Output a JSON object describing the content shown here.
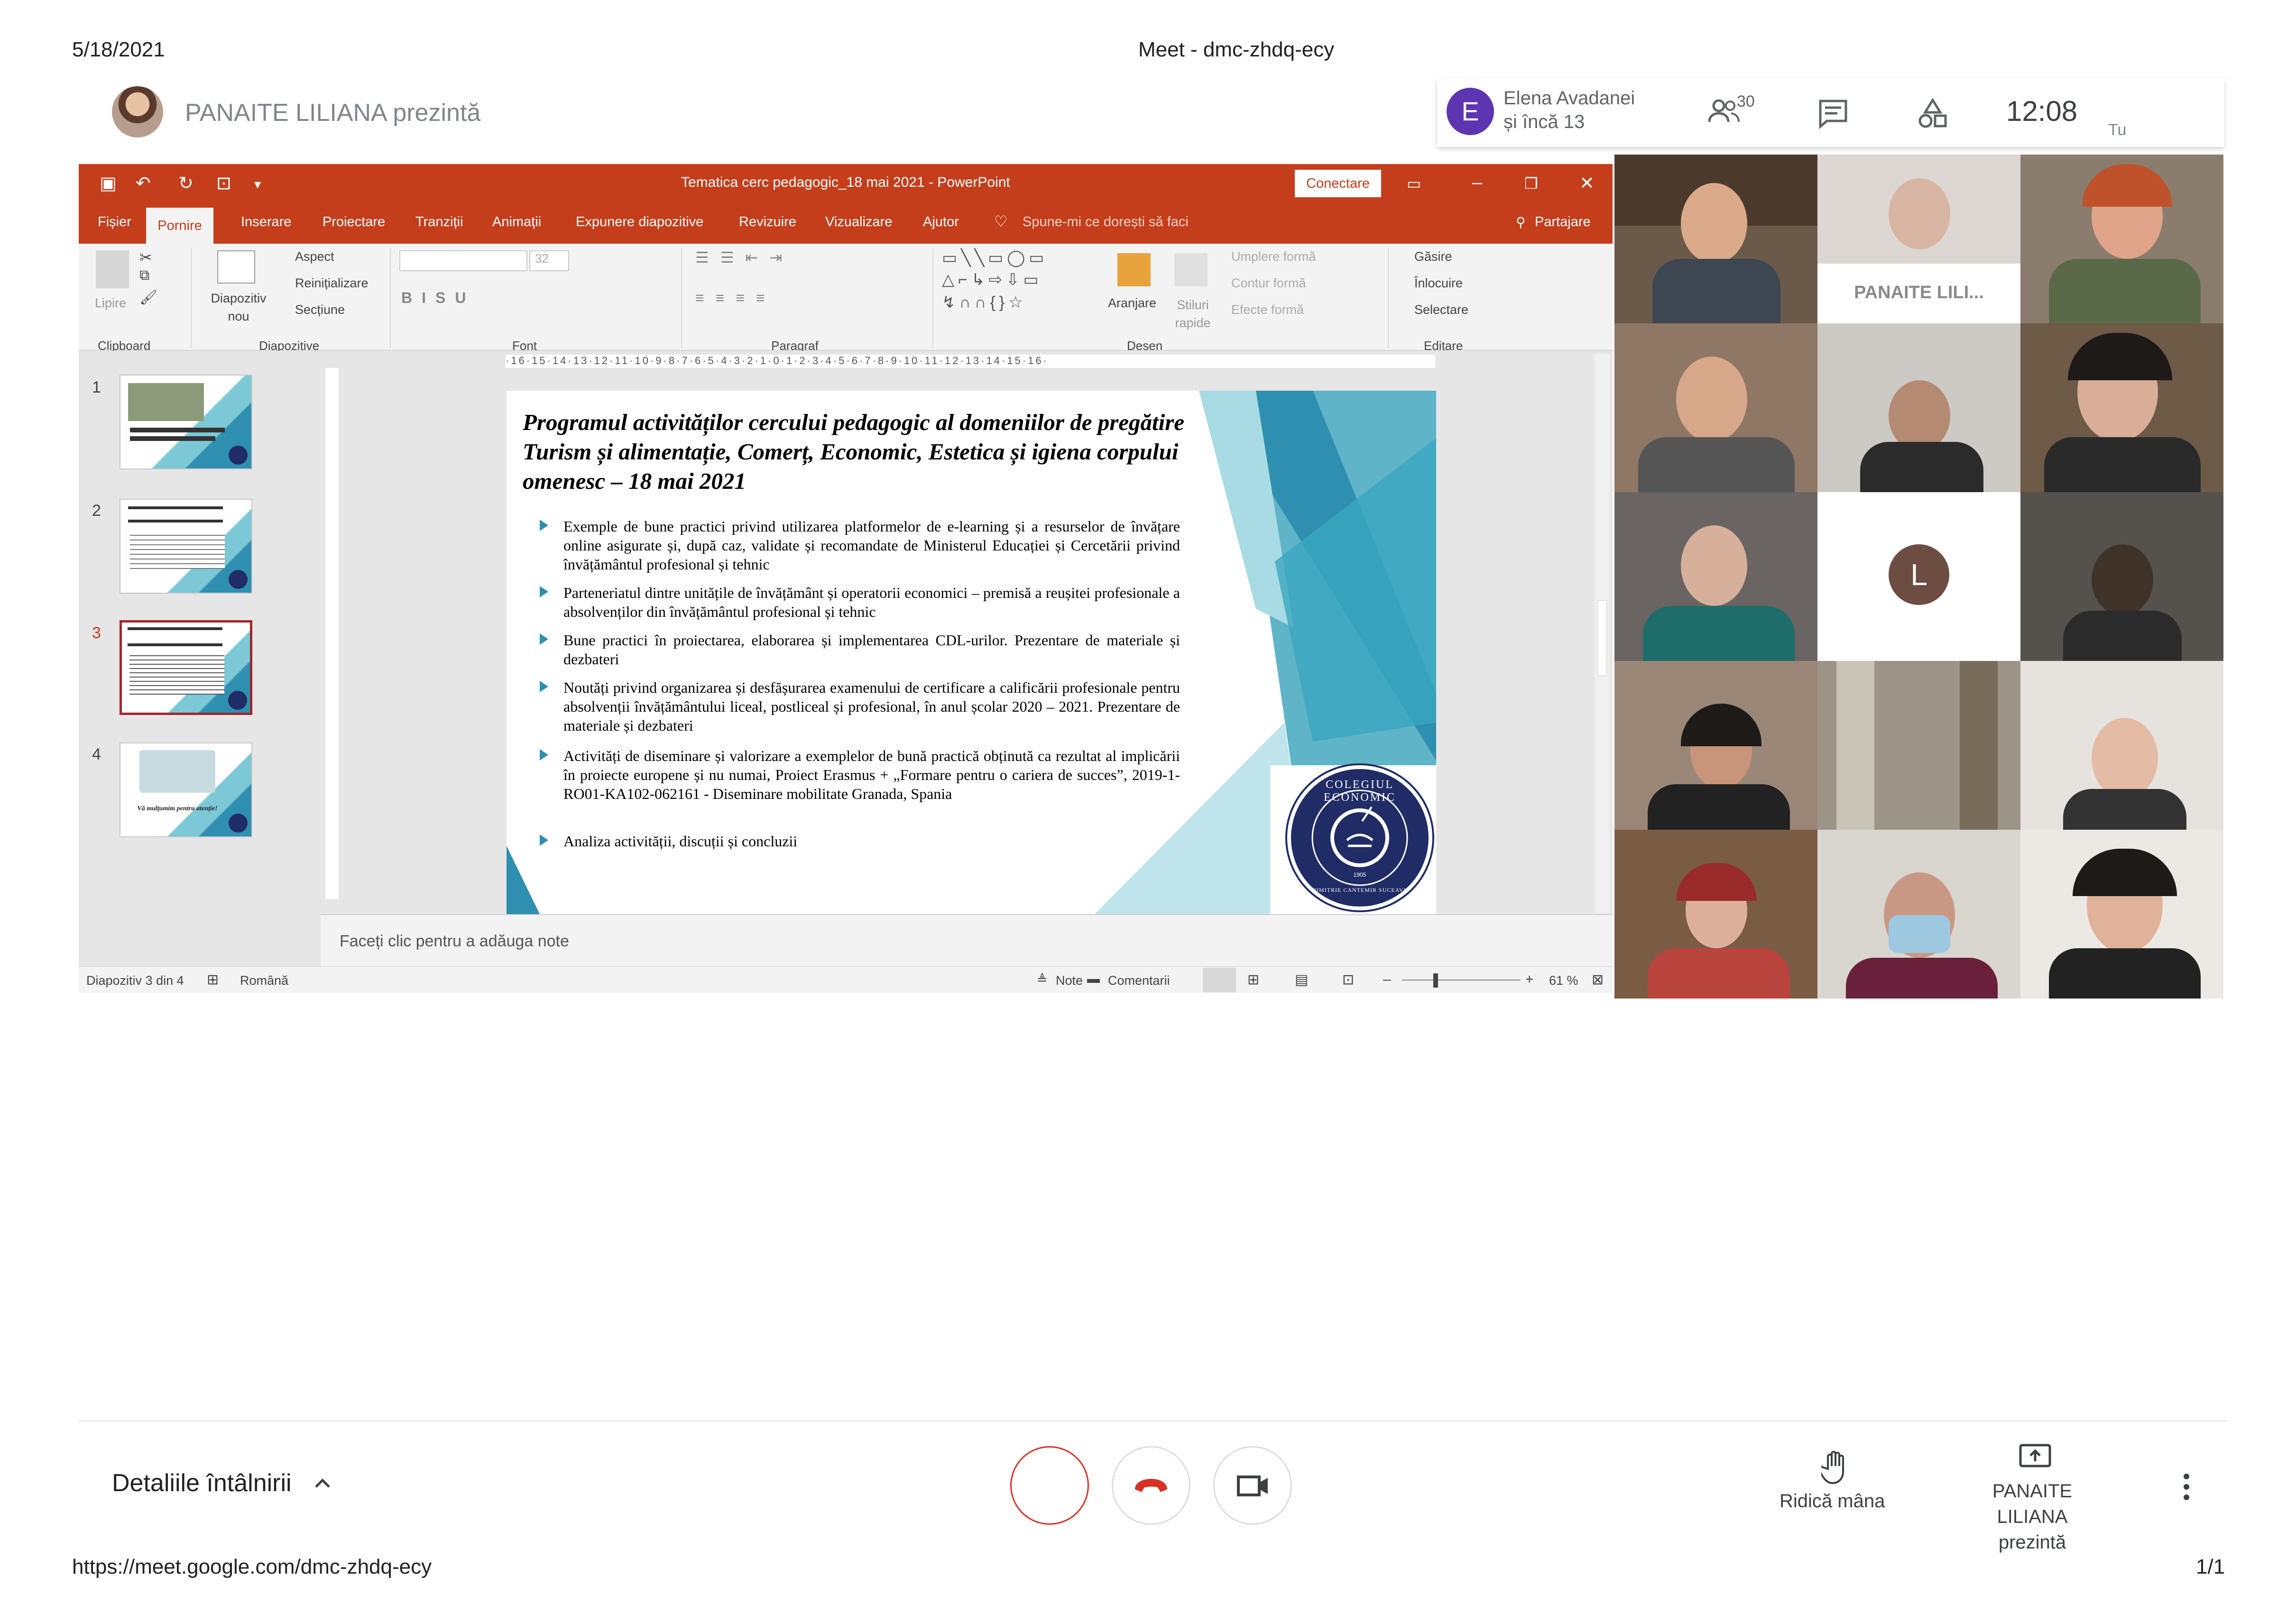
{
  "print_header": {
    "date": "5/18/2021",
    "title": "Meet - dmc-zhdq-ecy"
  },
  "print_footer": {
    "url": "https://meet.google.com/dmc-zhdq-ecy",
    "page": "1/1"
  },
  "presenter": {
    "label": "PANAITE LILIANA prezintă"
  },
  "info": {
    "avatar_letter": "E",
    "name": "Elena Avadanei",
    "more": "și încă 13",
    "participant_count": "30",
    "clock": "12:08",
    "you_label": "Tu"
  },
  "ppt": {
    "doc_title": "Tematica cerc pedagogic_18 mai 2021  -  PowerPoint",
    "connect": "Conectare",
    "tabs": [
      "Fișier",
      "Pornire",
      "Inserare",
      "Proiectare",
      "Tranziții",
      "Animații",
      "Expunere diapozitive",
      "Revizuire",
      "Vizualizare",
      "Ajutor"
    ],
    "tell_me": "Spune-mi ce dorești să faci",
    "share": "Partajare",
    "ribbon": {
      "lipire": "Lipire",
      "diapozitiv_nou": "Diapozitiv nou",
      "aspect": "Aspect",
      "reinitializare": "Reinițializare",
      "sectiune": "Secțiune",
      "font_size": "32",
      "aranjare": "Aranjare",
      "stiluri_rapide": "Stiluri rapide",
      "umplere": "Umplere formă",
      "contur": "Contur formă",
      "efecte": "Efecte formă",
      "gasire": "Găsire",
      "inlocuire": "Înlocuire",
      "selectare": "Selectare",
      "groups": [
        "Clipboard",
        "Diapozitive",
        "Font",
        "Paragraf",
        "Desen",
        "Editare"
      ]
    },
    "thumb_numbers": [
      "1",
      "2",
      "3",
      "4"
    ],
    "thumb4_caption": "Vă mulțumim pentru atenție!",
    "ruler": "·16·15·14·13·12·11·10·9·8·7·6·5·4·3·2·1·0·1·2·3·4·5·6·7·8·9·10·11·12·13·14·15·16·",
    "slide": {
      "title": "Programul activităților cercului pedagogic al domeniilor de pregătire Turism și alimentație, Comerț, Economic, Estetica și igiena corpului omenesc – 18 mai 2021",
      "bullets": [
        "Exemple de bune practici privind utilizarea platformelor de e-learning și a resurselor de învățare online asigurate și, după caz, validate și recomandate de Ministerul Educației și Cercetării privind învățământul profesional și tehnic",
        "Parteneriatul dintre unitățile de învățământ și operatorii economici – premisă a reușitei profesionale a absolvenților din învățământul profesional și tehnic",
        "Bune practici în proiectarea, elaborarea  și implementarea CDL-urilor. Prezentare de materiale și dezbateri",
        "Noutăți privind organizarea și desfășurarea examenului de certificare a calificării profesionale pentru absolvenții învățământului liceal, postliceal și profesional, în anul școlar 2020 – 2021. Prezentare de materiale și dezbateri",
        "Activități de diseminare și valorizare a exemplelor de bună practică obținută ca rezultat al implicării în proiecte europene și nu numai, Proiect Erasmus + „Formare pentru o cariera de succes”, 2019-1-RO01-KA102-062161 - Diseminare mobilitate Granada, Spania",
        "Analiza activității, discuții și concluzii"
      ],
      "logo_text": "COLEGIUL ECONOMIC",
      "logo_sub": "DIMITRIE CANTEMIR SUCEAVA",
      "logo_year": "1905"
    },
    "notes_placeholder": "Faceți clic pentru a adăuga note",
    "status": {
      "slide_of": "Diapozitiv 3 din 4",
      "language": "Română",
      "notes": "Note",
      "comments": "Comentarii",
      "zoom": "61 %"
    }
  },
  "grid": {
    "tile_label": "PANAITE LILI...",
    "letter_avatar": "L"
  },
  "bottom": {
    "details": "Detaliile întâlnirii",
    "raise_hand": "Ridică mâna",
    "present_line1": "PANAITE LILIANA",
    "present_line2": "prezintă"
  },
  "colors": {
    "ppt_red": "#c43e1c",
    "meet_red": "#d93025",
    "slide_teal": "#2e8fb0",
    "logo_navy": "#1f2c66"
  }
}
